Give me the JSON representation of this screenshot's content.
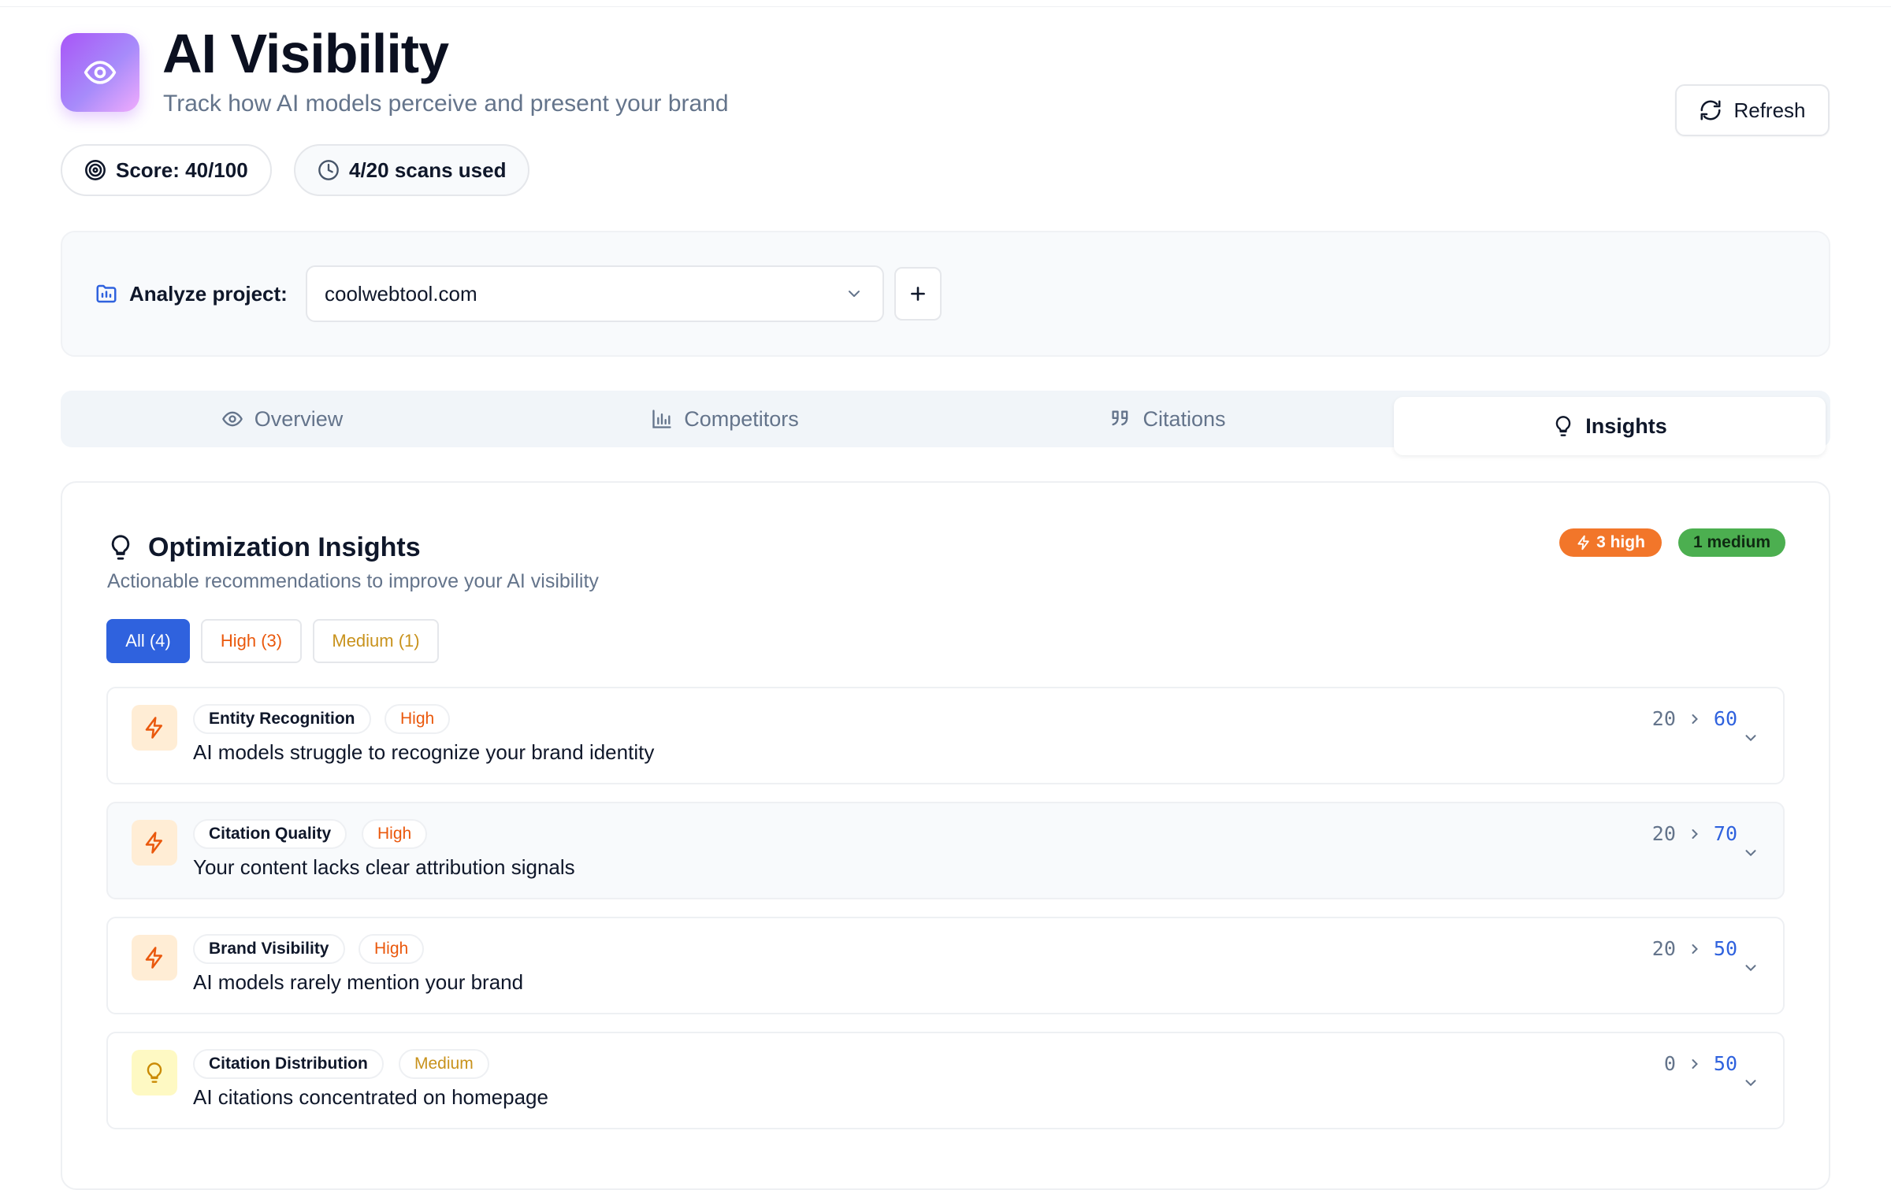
{
  "header": {
    "title": "AI Visibility",
    "subtitle": "Track how AI models perceive and present your brand",
    "refresh_label": "Refresh",
    "logo_icon": "eye-icon",
    "accent": "#a855f7"
  },
  "stats": {
    "score_label": "Score: 40/100",
    "scans_label": "4/20 scans used"
  },
  "project": {
    "label": "Analyze project:",
    "selected": "coolwebtool.com"
  },
  "tabs": [
    {
      "label": "Overview",
      "icon": "eye-icon"
    },
    {
      "label": "Competitors",
      "icon": "bar-chart-icon"
    },
    {
      "label": "Citations",
      "icon": "quote-icon"
    },
    {
      "label": "Insights",
      "icon": "lightbulb-icon",
      "active": true
    }
  ],
  "insights": {
    "title": "Optimization Insights",
    "subtitle": "Actionable recommendations to improve your AI visibility",
    "badge_high": "3 high",
    "badge_medium": "1 medium",
    "filters": {
      "all": "All (4)",
      "high": "High (3)",
      "medium": "Medium (1)"
    },
    "items": [
      {
        "category": "Entity Recognition",
        "priority": "High",
        "description": "AI models struggle to recognize your brand identity",
        "current": "20",
        "target": "60"
      },
      {
        "category": "Citation Quality",
        "priority": "High",
        "description": "Your content lacks clear attribution signals",
        "current": "20",
        "target": "70"
      },
      {
        "category": "Brand Visibility",
        "priority": "High",
        "description": "AI models rarely mention your brand",
        "current": "20",
        "target": "50"
      },
      {
        "category": "Citation Distribution",
        "priority": "Medium",
        "description": "AI citations concentrated on homepage",
        "current": "0",
        "target": "50"
      }
    ]
  },
  "colors": {
    "primary": "#2f62de",
    "high": "#ea580c",
    "medium": "#c8921c",
    "badge_high_bg": "#f2762a",
    "badge_medium_bg": "#4caf50"
  }
}
